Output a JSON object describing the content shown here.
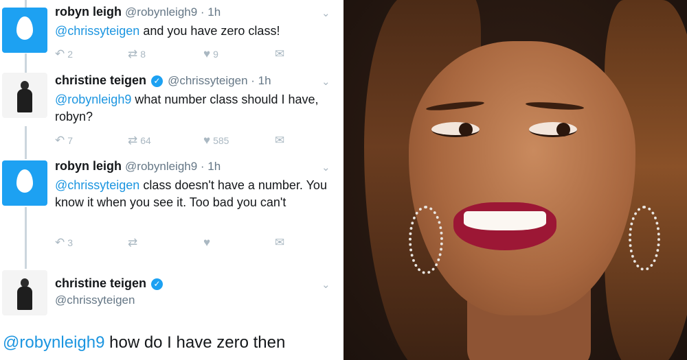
{
  "tweets": [
    {
      "name": "robyn leigh",
      "handle": "@robynleigh9 · 1h",
      "mention": "@chrissyteigen",
      "body": " and you have zero class!",
      "reply_count": "2",
      "retweet_count": "8",
      "like_count": "9",
      "avatar": "default-egg"
    },
    {
      "name": "christine teigen",
      "handle": "@chrissyteigen · 1h",
      "mention": "@robynleigh9",
      "body": " what number class should I have, robyn?",
      "reply_count": "7",
      "retweet_count": "64",
      "like_count": "585",
      "avatar": "profile-photo",
      "verified": true
    },
    {
      "name": "robyn leigh",
      "handle": "@robynleigh9 · 1h",
      "mention": "@chrissyteigen",
      "body": " class doesn't have a number. You know it when you see it.  Too bad you can't",
      "reply_count": "3",
      "retweet_count": "",
      "like_count": "",
      "avatar": "default-egg"
    },
    {
      "name": "christine teigen",
      "handle": "@chrissyteigen",
      "avatar": "profile-photo",
      "verified": true
    }
  ],
  "final_reply": {
    "mention": "@robynleigh9",
    "body": " how do I have zero then"
  },
  "icons": {
    "reply": "reply-arrow-icon",
    "retweet": "retweet-icon",
    "like": "heart-icon",
    "dm": "envelope-icon",
    "more": "chevron-down-icon",
    "verified": "verified-badge-icon"
  },
  "colors": {
    "link": "#1b95e0",
    "egg_bg": "#1da1f2",
    "action_gray": "#aab8c2",
    "thread_line": "#ccd6dd"
  }
}
